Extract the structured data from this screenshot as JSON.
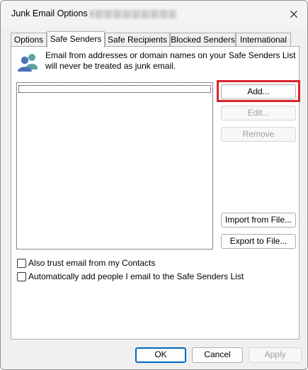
{
  "window": {
    "title": "Junk Email Options - ",
    "close_icon": "close-icon"
  },
  "tabs": [
    {
      "label": "Options"
    },
    {
      "label": "Safe Senders"
    },
    {
      "label": "Safe Recipients"
    },
    {
      "label": "Blocked Senders"
    },
    {
      "label": "International"
    }
  ],
  "active_tab": "Safe Senders",
  "safe_senders": {
    "info_icon": "people-icon",
    "description": "Email from addresses or domain names on your Safe Senders List will never be treated as junk email.",
    "list_items": [],
    "buttons": {
      "add": "Add...",
      "edit": "Edit...",
      "remove": "Remove",
      "import": "Import from File...",
      "export": "Export to File..."
    },
    "checkboxes": [
      {
        "label": "Also trust email from my Contacts",
        "checked": false
      },
      {
        "label": "Automatically add people I email to the Safe Senders List",
        "checked": false
      }
    ]
  },
  "footer": {
    "ok": "OK",
    "cancel": "Cancel",
    "apply": "Apply"
  },
  "colors": {
    "highlight": "#d9232e",
    "accent": "#0067c0",
    "icon_front": "#4a73b8",
    "icon_back": "#5aa3a5"
  }
}
